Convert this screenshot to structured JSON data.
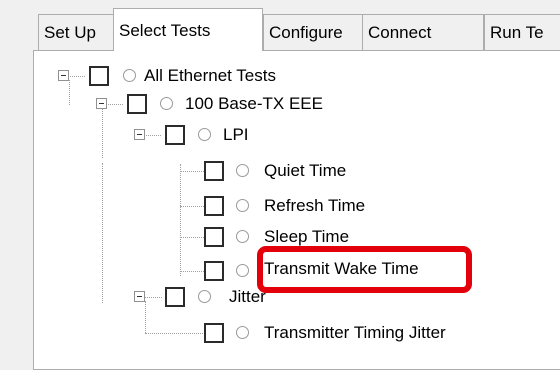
{
  "tabs": [
    "Set Up",
    "Select Tests",
    "Configure",
    "Connect",
    "Run Te"
  ],
  "tree": {
    "root": "All Ethernet Tests",
    "group": "100 Base-TX EEE",
    "lpi": "LPI",
    "lpi_items": [
      "Quiet Time",
      "Refresh Time",
      "Sleep Time",
      "Transmit Wake Time"
    ],
    "jitter": "Jitter",
    "jitter_items": [
      "Transmitter Timing Jitter"
    ]
  },
  "highlight": {
    "target": "Transmit Wake Time",
    "color": "#e3000b"
  }
}
